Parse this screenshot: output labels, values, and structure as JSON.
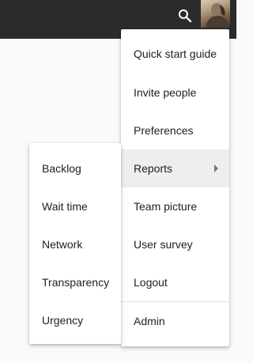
{
  "header": {
    "search_icon": "search-icon",
    "avatar": "user-avatar"
  },
  "main_menu": {
    "items": [
      {
        "label": "Quick start guide"
      },
      {
        "label": "Invite people"
      },
      {
        "label": "Preferences"
      },
      {
        "label": "Reports",
        "has_submenu": true,
        "active": true
      },
      {
        "label": "Team picture"
      },
      {
        "label": "User survey"
      },
      {
        "label": "Logout"
      },
      {
        "label": "Admin"
      }
    ]
  },
  "reports_submenu": {
    "items": [
      {
        "label": "Backlog"
      },
      {
        "label": "Wait time"
      },
      {
        "label": "Network"
      },
      {
        "label": "Transparency"
      },
      {
        "label": "Urgency"
      }
    ]
  },
  "colors": {
    "topbar": "#2b2b2b",
    "active_item": "#eeeeee",
    "text": "#212121"
  }
}
